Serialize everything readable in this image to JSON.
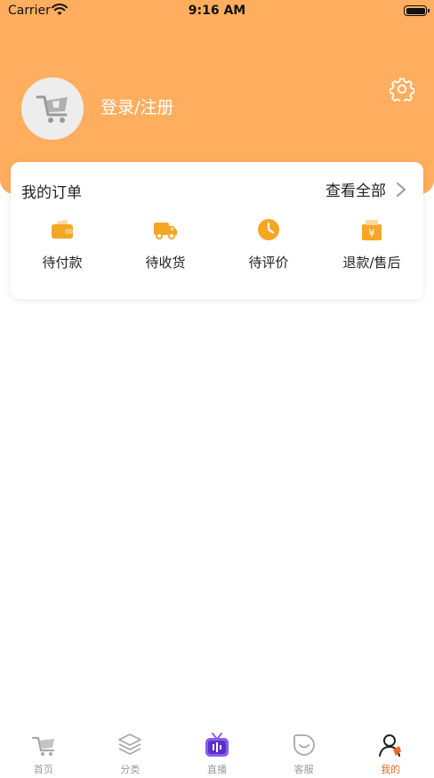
{
  "status_bar": {
    "carrier": "Carrier",
    "time": "9:16 AM",
    "icons": [
      "wifi-icon",
      "battery-icon"
    ]
  },
  "header": {
    "login_label": "登录/注册",
    "settings_icon": "gear-icon",
    "background_color": "#FFAE5F"
  },
  "orders": {
    "title": "我的订单",
    "view_all_label": "查看全部",
    "items": [
      {
        "label": "待付款",
        "icon": "wallet-icon"
      },
      {
        "label": "待收货",
        "icon": "truck-icon"
      },
      {
        "label": "待评价",
        "icon": "clock-icon"
      },
      {
        "label": "退款/售后",
        "icon": "refund-icon"
      }
    ],
    "accent_color": "#F5A623"
  },
  "tab_bar": {
    "tabs": [
      {
        "label": "首页",
        "icon": "home-icon",
        "active": false
      },
      {
        "label": "分类",
        "icon": "layers-icon",
        "active": false
      },
      {
        "label": "直播",
        "icon": "tv-icon",
        "active": false
      },
      {
        "label": "客服",
        "icon": "smile-icon",
        "active": false
      },
      {
        "label": "我的",
        "icon": "user-icon",
        "active": true
      }
    ],
    "active_color": "#E8682A",
    "inactive_color": "#9A9A9A"
  }
}
